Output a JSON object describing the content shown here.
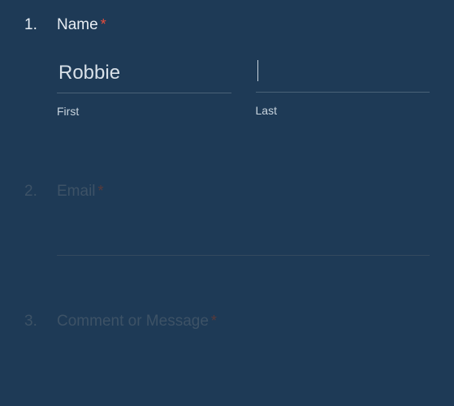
{
  "fields": {
    "name": {
      "number": "1.",
      "label": "Name",
      "required": "*",
      "first": {
        "value": "Robbie",
        "sublabel": "First"
      },
      "last": {
        "value": "",
        "sublabel": "Last"
      }
    },
    "email": {
      "number": "2.",
      "label": "Email",
      "required": "*",
      "value": ""
    },
    "comment": {
      "number": "3.",
      "label": "Comment or Message",
      "required": "*"
    }
  }
}
